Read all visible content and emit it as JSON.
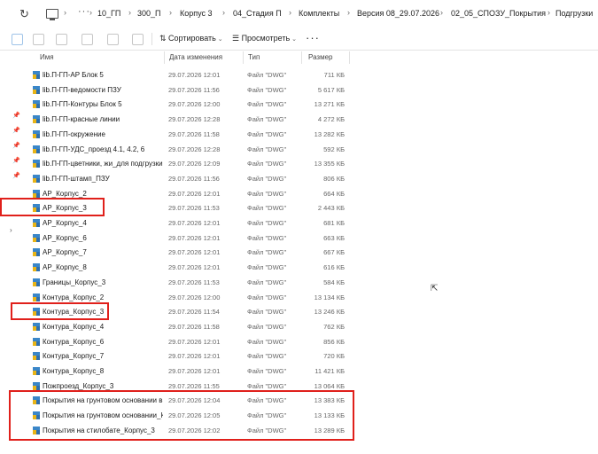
{
  "address_bar": {
    "more": "···",
    "crumbs": [
      "10_ГП",
      "300_П",
      "Корпус 3",
      "04_Стадия П",
      "Комплекты",
      "Версия 08_29.07.2026",
      "02_05_СПОЗУ_Покрытия",
      "Подгрузки"
    ]
  },
  "command_bar": {
    "sort_label": "Сортировать",
    "view_label": "Просмотреть",
    "more": "···"
  },
  "columns": {
    "name": "Имя",
    "date": "Дата изменения",
    "type": "Тип",
    "size": "Размер"
  },
  "files": [
    {
      "name": "lib.П-ГП-АР Блок 5",
      "date": "29.07.2026 12:01",
      "type": "Файл \"DWG\"",
      "size": "711 КБ"
    },
    {
      "name": "lib.П-ГП-ведомости ПЗУ",
      "date": "29.07.2026 11:56",
      "type": "Файл \"DWG\"",
      "size": "5 617 КБ"
    },
    {
      "name": "lib.П-ГП-Контуры Блок 5",
      "date": "29.07.2026 12:00",
      "type": "Файл \"DWG\"",
      "size": "13 271 КБ"
    },
    {
      "name": "lib.П-ГП-красные линии",
      "date": "29.07.2026 12:28",
      "type": "Файл \"DWG\"",
      "size": "4 272 КБ"
    },
    {
      "name": "lib.П-ГП-окружение",
      "date": "29.07.2026 11:58",
      "type": "Файл \"DWG\"",
      "size": "13 282 КБ"
    },
    {
      "name": "lib.П-ГП-УДС_проезд 4.1, 4.2, 6",
      "date": "29.07.2026 12:28",
      "type": "Файл \"DWG\"",
      "size": "592 КБ"
    },
    {
      "name": "lib.П-ГП-цветники, жи_для подгрузки",
      "date": "29.07.2026 12:09",
      "type": "Файл \"DWG\"",
      "size": "13 355 КБ"
    },
    {
      "name": "lib.П-ГП-штамп_ПЗУ",
      "date": "29.07.2026 11:56",
      "type": "Файл \"DWG\"",
      "size": "806 КБ"
    },
    {
      "name": "АР_Корпус_2",
      "date": "29.07.2026 12:01",
      "type": "Файл \"DWG\"",
      "size": "664 КБ"
    },
    {
      "name": "АР_Корпус_3",
      "date": "29.07.2026 11:53",
      "type": "Файл \"DWG\"",
      "size": "2 443 КБ"
    },
    {
      "name": "АР_Корпус_4",
      "date": "29.07.2026 12:01",
      "type": "Файл \"DWG\"",
      "size": "681 КБ"
    },
    {
      "name": "АР_Корпус_6",
      "date": "29.07.2026 12:01",
      "type": "Файл \"DWG\"",
      "size": "663 КБ"
    },
    {
      "name": "АР_Корпус_7",
      "date": "29.07.2026 12:01",
      "type": "Файл \"DWG\"",
      "size": "667 КБ"
    },
    {
      "name": "АР_Корпус_8",
      "date": "29.07.2026 12:01",
      "type": "Файл \"DWG\"",
      "size": "616 КБ"
    },
    {
      "name": "Границы_Корпус_3",
      "date": "29.07.2026 11:53",
      "type": "Файл \"DWG\"",
      "size": "584 КБ"
    },
    {
      "name": "Контура_Корпус_2",
      "date": "29.07.2026 12:00",
      "type": "Файл \"DWG\"",
      "size": "13 134 КБ"
    },
    {
      "name": "Контура_Корпус_3",
      "date": "29.07.2026 11:54",
      "type": "Файл \"DWG\"",
      "size": "13 246 КБ"
    },
    {
      "name": "Контура_Корпус_4",
      "date": "29.07.2026 11:58",
      "type": "Файл \"DWG\"",
      "size": "762 КБ"
    },
    {
      "name": "Контура_Корпус_6",
      "date": "29.07.2026 12:01",
      "type": "Файл \"DWG\"",
      "size": "856 КБ"
    },
    {
      "name": "Контура_Корпус_7",
      "date": "29.07.2026 12:01",
      "type": "Файл \"DWG\"",
      "size": "720 КБ"
    },
    {
      "name": "Контура_Корпус_8",
      "date": "29.07.2026 12:01",
      "type": "Файл \"DWG\"",
      "size": "11 421 КБ"
    },
    {
      "name": "Пожпроезд_Корпус_3",
      "date": "29.07.2026 11:55",
      "type": "Файл \"DWG\"",
      "size": "13 064 КБ"
    },
    {
      "name": "Покрытия на грунтовом основании в г...",
      "date": "29.07.2026 12:04",
      "type": "Файл \"DWG\"",
      "size": "13 383 КБ"
    },
    {
      "name": "Покрытия на грунтовом основании_Ко...",
      "date": "29.07.2026 12:05",
      "type": "Файл \"DWG\"",
      "size": "13 133 КБ"
    },
    {
      "name": "Покрытия на стилобате_Корпус_3",
      "date": "29.07.2026 12:02",
      "type": "Файл \"DWG\"",
      "size": "13 289 КБ"
    }
  ],
  "colors": {
    "highlight": "#e0201b",
    "dwg_icon_blue": "#3a86c8",
    "dwg_icon_yellow": "#e8b417"
  }
}
